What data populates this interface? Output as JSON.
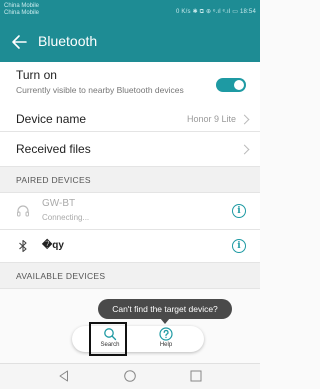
{
  "status_bar": {
    "carrier_line1": "China Mobile",
    "carrier_line2": "China Mobile",
    "right_text": "0 K/s ✱ ⧉ ⊕ ᵉ.ıl ᵉ.ıl ▭ 18:54"
  },
  "app_bar": {
    "title": "Bluetooth"
  },
  "turn_on": {
    "title": "Turn on",
    "subtitle": "Currently visible to nearby Bluetooth devices",
    "enabled": true
  },
  "device_name": {
    "label": "Device name",
    "value": "Honor 9 Lite"
  },
  "received_files": {
    "label": "Received files"
  },
  "paired_section": {
    "title": "PAIRED DEVICES"
  },
  "paired_devices": [
    {
      "name": "GW-BT",
      "status": "Connecting...",
      "icon": "headset-icon"
    },
    {
      "name": "�qy",
      "status": "",
      "icon": "bluetooth-icon"
    }
  ],
  "available_section": {
    "title": "AVAILABLE DEVICES"
  },
  "tooltip": {
    "text": "Can't find the target device?"
  },
  "actions": {
    "search_label": "Search",
    "help_label": "Help"
  },
  "colors": {
    "accent": "#1e8c94",
    "toggle": "#1e9aa3"
  }
}
